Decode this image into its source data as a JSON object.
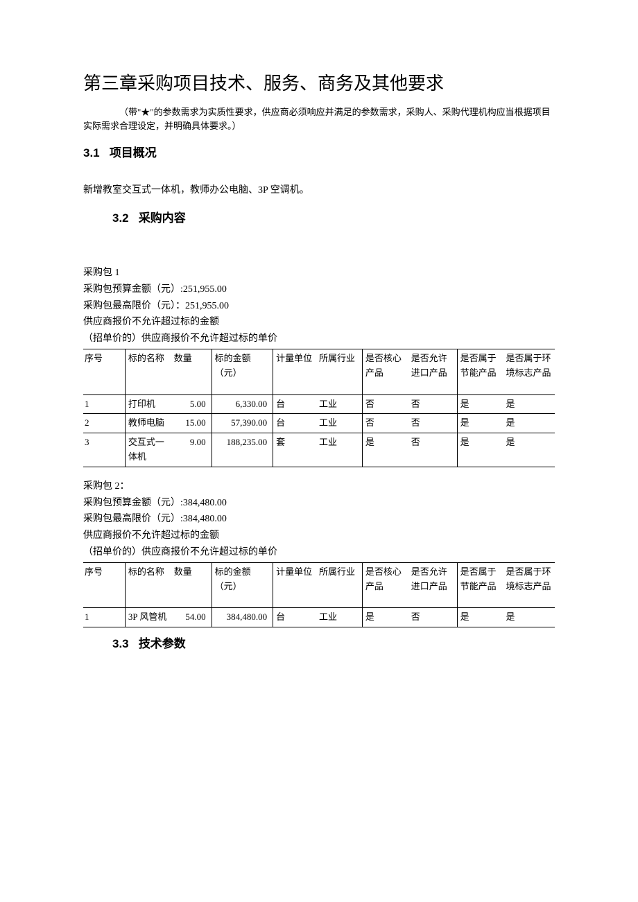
{
  "title": "第三章采购项目技术、服务、商务及其他要求",
  "intro": "（带\"★\"的参数需求为实质性要求，供应商必须响应并满足的参数需求，采购人、采购代理机构应当根据项目实际需求合理设定，并明确具体要求。）",
  "sec31": {
    "num": "3.1",
    "title": "项目概况",
    "body": "新增教室交互式一体机，教师办公电脑、3P 空调机。"
  },
  "sec32": {
    "num": "3.2",
    "title": "采购内容"
  },
  "sec33": {
    "num": "3.3",
    "title": "技术参数"
  },
  "pkg1": {
    "l1": "采购包 1",
    "l2": "采购包预算金额（元）:251,955.00",
    "l3": "采购包最高限价（元）：251,955.00",
    "l4": "供应商报价不允许超过标的金额",
    "l5": "（招单价的）供应商报价不允许超过标的单价"
  },
  "pkg2": {
    "l1": "采购包 2：",
    "l2": "采购包预算金额（元）:384,480.00",
    "l3": "采购包最高限价（元）:384,480.00",
    "l4": "供应商报价不允许超过标的金额",
    "l5": "（招单价的）供应商报价不允许超过标的单价"
  },
  "thead": {
    "seq": "序号",
    "name": "标的名称",
    "qty": "数量",
    "amt": "标的金额（元）",
    "unit": "计量单位",
    "ind": "所属行业",
    "core": "是否核心产品",
    "imp": "是否允许进口产品",
    "energy": "是否属于节能产品",
    "env": "是否属于环境标志产品"
  },
  "thead2_unit": "计量单位",
  "thead2_ind": "所属行业",
  "t1": {
    "r1": {
      "seq": "1",
      "name": "打印机",
      "qty": "5.00",
      "amt": "6,330.00",
      "unit": "台",
      "ind": "工业",
      "core": "否",
      "imp": "否",
      "energy": "是",
      "env": "是"
    },
    "r2": {
      "seq": "2",
      "name": "教师电脑",
      "qty": "15.00",
      "amt": "57,390.00",
      "unit": "台",
      "ind": "工业",
      "core": "否",
      "imp": "否",
      "energy": "是",
      "env": "是"
    },
    "r3": {
      "seq": "3",
      "name": "交互式一体机",
      "qty": "9.00",
      "amt": "188,235.00",
      "unit": "套",
      "ind": "工业",
      "core": "是",
      "imp": "否",
      "energy": "是",
      "env": "是"
    }
  },
  "t2": {
    "r1": {
      "seq": "1",
      "name": "3P 风管机",
      "qty": "54.00",
      "amt": "384,480.00",
      "unit": "台",
      "ind": "工业",
      "core": "是",
      "imp": "否",
      "energy": "是",
      "env": "是"
    }
  },
  "chart_data": [
    {
      "type": "table",
      "title": "采购包 1",
      "columns": [
        "序号",
        "标的名称",
        "数量",
        "标的金额（元）",
        "计量单位",
        "所属行业",
        "是否核心产品",
        "是否允许进口产品",
        "是否属于节能产品",
        "是否属于环境标志产品"
      ],
      "rows": [
        [
          1,
          "打印机",
          5.0,
          6330.0,
          "台",
          "工业",
          "否",
          "否",
          "是",
          "是"
        ],
        [
          2,
          "教师电脑",
          15.0,
          57390.0,
          "台",
          "工业",
          "否",
          "否",
          "是",
          "是"
        ],
        [
          3,
          "交互式一体机",
          9.0,
          188235.0,
          "套",
          "工业",
          "是",
          "否",
          "是",
          "是"
        ]
      ],
      "budget": 251955.0,
      "price_cap": 251955.0
    },
    {
      "type": "table",
      "title": "采购包 2",
      "columns": [
        "序号",
        "标的名称",
        "数量",
        "标的金额（元）",
        "计量单位",
        "所属行业",
        "是否核心产品",
        "是否允许进口产品",
        "是否属于节能产品",
        "是否属于环境标志产品"
      ],
      "rows": [
        [
          1,
          "3P 风管机",
          54.0,
          384480.0,
          "台",
          "工业",
          "是",
          "否",
          "是",
          "是"
        ]
      ],
      "budget": 384480.0,
      "price_cap": 384480.0
    }
  ]
}
